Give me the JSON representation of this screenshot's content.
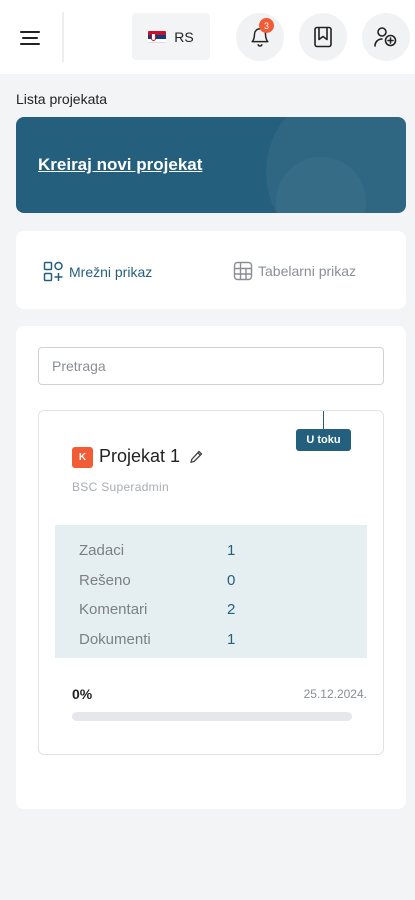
{
  "header": {
    "language_code": "RS",
    "notification_count": "3",
    "icons": {
      "menu": "hamburger-menu-icon",
      "flag": "serbia-flag-icon",
      "notifications": "bell-icon",
      "saved": "bookmark-icon",
      "users": "users-icon"
    }
  },
  "page": {
    "title": "Lista projekata"
  },
  "create_project": {
    "label": "Kreiraj novi projekat"
  },
  "views": {
    "grid_label": "Mrežni prikaz",
    "table_label": "Tabelarni prikaz",
    "grid_icon": "grid-view-icon",
    "table_icon": "table-view-icon",
    "active": "grid"
  },
  "search": {
    "placeholder": "Pretraga",
    "value": ""
  },
  "projects": [
    {
      "status": "U toku",
      "avatar_letter": "K",
      "name": "Projekat 1",
      "owner": "BSC Superadmin",
      "stats": [
        {
          "label": "Zadaci",
          "value": "1"
        },
        {
          "label": "Rešeno",
          "value": "0"
        },
        {
          "label": "Komentari",
          "value": "2"
        },
        {
          "label": "Dokumenti",
          "value": "1"
        }
      ],
      "progress_label": "0%",
      "progress_value": 0,
      "date": "25.12.2024."
    }
  ],
  "colors": {
    "primary": "#245f7d",
    "accent": "#f15b35",
    "stats_bg": "#e5eef1",
    "page_bg": "#f3f4f6"
  }
}
